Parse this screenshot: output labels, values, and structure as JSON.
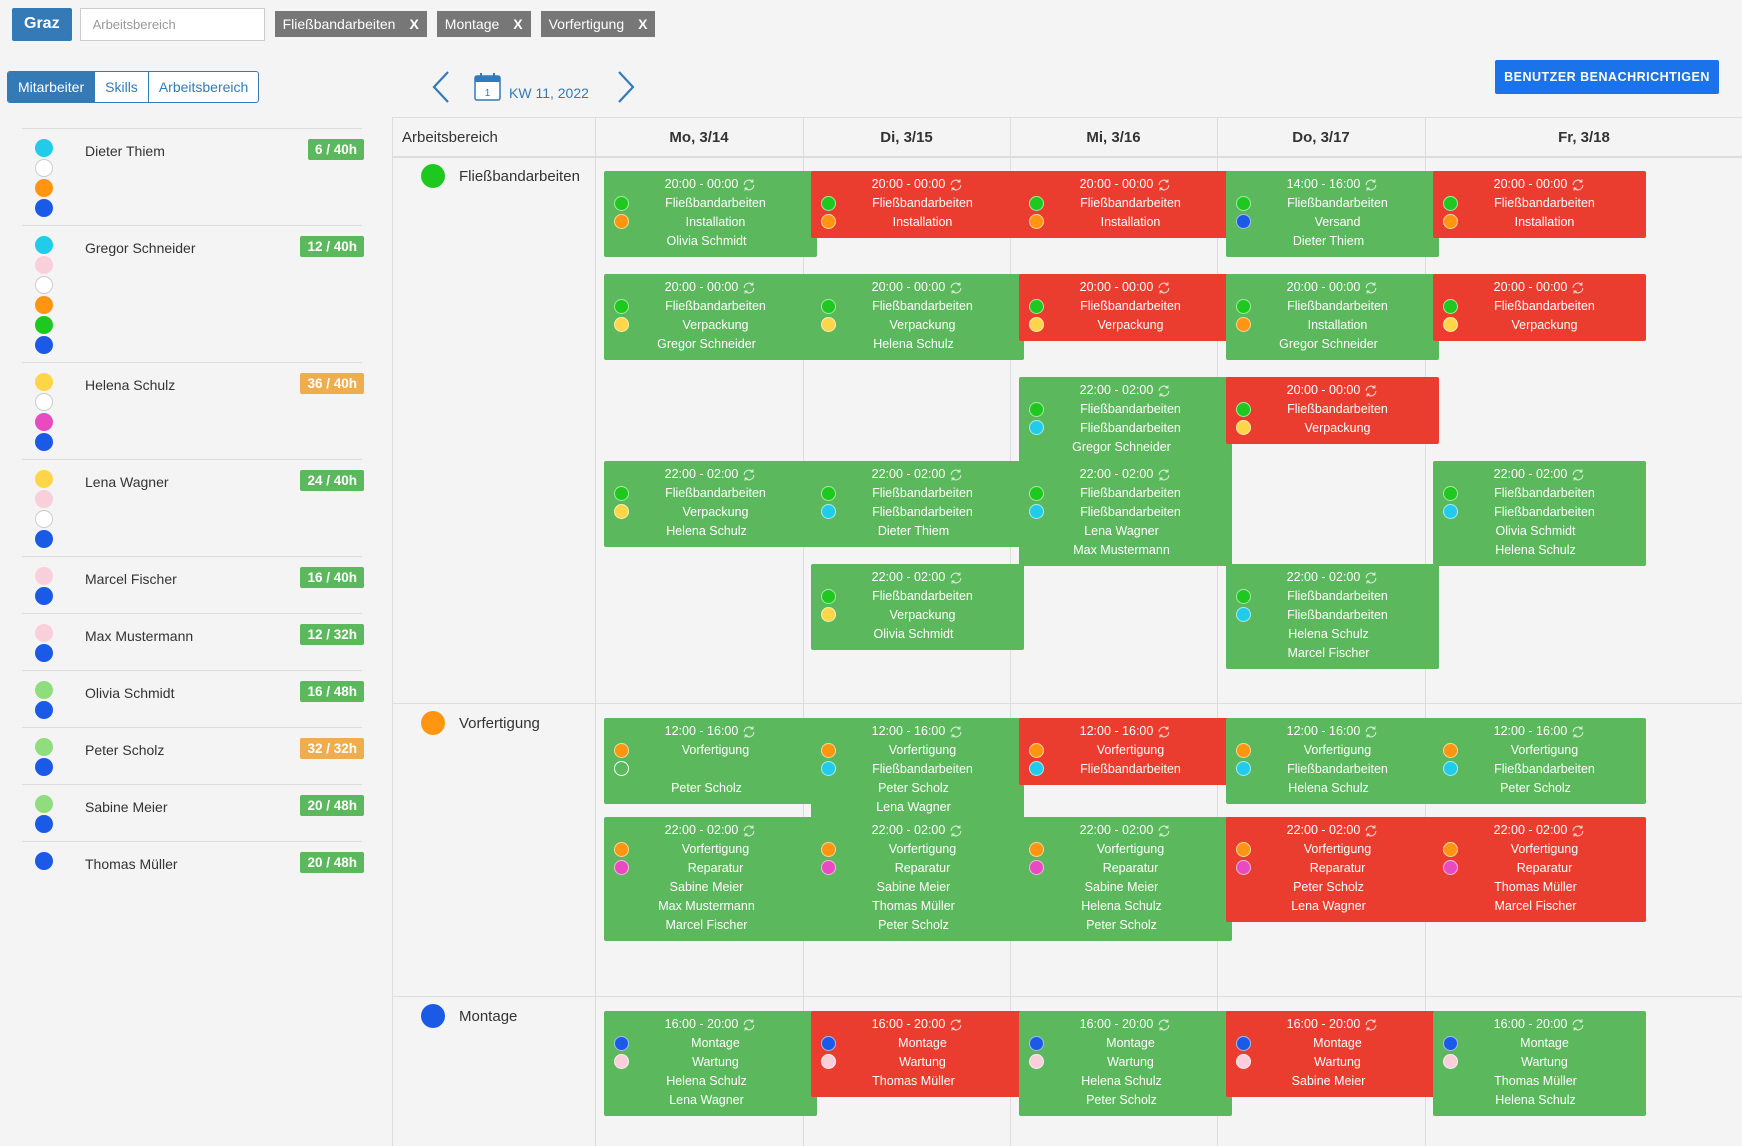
{
  "location": "Graz",
  "area_search": {
    "placeholder": "Arbeitsbereich"
  },
  "filter_chips": [
    {
      "label": "Fließbandarbeiten",
      "remove": "X"
    },
    {
      "label": "Montage",
      "remove": "X"
    },
    {
      "label": "Vorfertigung",
      "remove": "X"
    }
  ],
  "view_tabs": [
    "Mitarbeiter",
    "Skills",
    "Arbeitsbereich"
  ],
  "week": {
    "calendar_day": "1",
    "label": "KW 11, 2022"
  },
  "notify_button": "BENUTZER BENACHRICHTIGEN",
  "colors": {
    "cyan": "#22cbea",
    "pink": "#f9cfdc",
    "orange": "#ff9511",
    "blue": "#1b5ae6",
    "green": "#1fc81f",
    "yellow": "#ffd54a",
    "magenta": "#e84bbf",
    "lightgreen": "#8fdd7d",
    "badge_green": "#5cb85c",
    "badge_orange": "#f0ad4e",
    "card_green": "#5cb85c",
    "card_red": "#ea3c2f"
  },
  "employees": [
    {
      "name": "Dieter Thiem",
      "hours": "6 / 40h",
      "status": "green",
      "skills": [
        "cyan",
        "empty",
        "orange",
        "blue"
      ]
    },
    {
      "name": "Gregor Schneider",
      "hours": "12 / 40h",
      "status": "green",
      "skills": [
        "cyan",
        "pink",
        "empty",
        "orange",
        "green",
        "blue"
      ]
    },
    {
      "name": "Helena Schulz",
      "hours": "36 / 40h",
      "status": "orange",
      "skills": [
        "yellow",
        "empty",
        "magenta",
        "blue"
      ]
    },
    {
      "name": "Lena Wagner",
      "hours": "24 / 40h",
      "status": "green",
      "skills": [
        "yellow",
        "pink",
        "empty",
        "blue"
      ]
    },
    {
      "name": "Marcel Fischer",
      "hours": "16 / 40h",
      "status": "green",
      "skills": [
        "pink",
        "blue"
      ]
    },
    {
      "name": "Max Mustermann",
      "hours": "12 / 32h",
      "status": "green",
      "skills": [
        "pink",
        "blue"
      ]
    },
    {
      "name": "Olivia Schmidt",
      "hours": "16 / 48h",
      "status": "green",
      "skills": [
        "lightgreen",
        "blue"
      ]
    },
    {
      "name": "Peter Scholz",
      "hours": "32 / 32h",
      "status": "orange",
      "skills": [
        "lightgreen",
        "blue"
      ]
    },
    {
      "name": "Sabine Meier",
      "hours": "20 / 48h",
      "status": "green",
      "skills": [
        "lightgreen",
        "blue"
      ]
    },
    {
      "name": "Thomas Müller",
      "hours": "20 / 48h",
      "status": "green",
      "skills": [
        "blue"
      ]
    }
  ],
  "schedule": {
    "area_header": "Arbeitsbereich",
    "days": [
      "Mo, 3/14",
      "Di, 3/15",
      "Mi, 3/16",
      "Do, 3/17",
      "Fr, 3/18"
    ],
    "areas": [
      {
        "name": "Fließbandarbeiten",
        "color": "green"
      },
      {
        "name": "Vorfertigung",
        "color": "orange"
      },
      {
        "name": "Montage",
        "color": "blue"
      }
    ],
    "shifts": [
      {
        "area": 0,
        "day": 0,
        "slot": 0,
        "status": "green",
        "time": "20:00 - 00:00",
        "dots": [
          "green",
          "orange"
        ],
        "lines": [
          "Fließbandarbeiten",
          "Installation",
          "Olivia Schmidt"
        ]
      },
      {
        "area": 0,
        "day": 0,
        "slot": 1,
        "status": "green",
        "time": "20:00 - 00:00",
        "dots": [
          "green",
          "yellow"
        ],
        "lines": [
          "Fließbandarbeiten",
          "Verpackung",
          "Gregor Schneider"
        ]
      },
      {
        "area": 0,
        "day": 0,
        "slot": 3,
        "status": "green",
        "time": "22:00 - 02:00",
        "dots": [
          "green",
          "yellow"
        ],
        "lines": [
          "Fließbandarbeiten",
          "Verpackung",
          "Helena Schulz"
        ]
      },
      {
        "area": 0,
        "day": 1,
        "slot": 0,
        "status": "red",
        "time": "20:00 - 00:00",
        "dots": [
          "green",
          "orange"
        ],
        "lines": [
          "Fließbandarbeiten",
          "Installation"
        ]
      },
      {
        "area": 0,
        "day": 1,
        "slot": 1,
        "status": "green",
        "time": "20:00 - 00:00",
        "dots": [
          "green",
          "yellow"
        ],
        "lines": [
          "Fließbandarbeiten",
          "Verpackung",
          "Helena Schulz"
        ]
      },
      {
        "area": 0,
        "day": 1,
        "slot": 3,
        "status": "green",
        "time": "22:00 - 02:00",
        "dots": [
          "green",
          "cyan"
        ],
        "lines": [
          "Fließbandarbeiten",
          "Fließbandarbeiten",
          "Dieter Thiem"
        ]
      },
      {
        "area": 0,
        "day": 1,
        "slot": 4,
        "status": "green",
        "time": "22:00 - 02:00",
        "dots": [
          "green",
          "yellow"
        ],
        "lines": [
          "Fließbandarbeiten",
          "Verpackung",
          "Olivia Schmidt"
        ]
      },
      {
        "area": 0,
        "day": 2,
        "slot": 0,
        "status": "red",
        "time": "20:00 - 00:00",
        "dots": [
          "green",
          "orange"
        ],
        "lines": [
          "Fließbandarbeiten",
          "Installation"
        ]
      },
      {
        "area": 0,
        "day": 2,
        "slot": 1,
        "status": "red",
        "time": "20:00 - 00:00",
        "dots": [
          "green",
          "yellow"
        ],
        "lines": [
          "Fließbandarbeiten",
          "Verpackung"
        ]
      },
      {
        "area": 0,
        "day": 2,
        "slot": 2,
        "status": "green",
        "time": "22:00 - 02:00",
        "dots": [
          "green",
          "cyan"
        ],
        "lines": [
          "Fließbandarbeiten",
          "Fließbandarbeiten",
          "Gregor Schneider"
        ]
      },
      {
        "area": 0,
        "day": 2,
        "slot": 3,
        "status": "green",
        "time": "22:00 - 02:00",
        "dots": [
          "green",
          "cyan"
        ],
        "lines": [
          "Fließbandarbeiten",
          "Fließbandarbeiten",
          "Lena Wagner",
          "Max Mustermann"
        ]
      },
      {
        "area": 0,
        "day": 3,
        "slot": 0,
        "status": "green",
        "time": "14:00 - 16:00",
        "dots": [
          "green",
          "blue"
        ],
        "lines": [
          "Fließbandarbeiten",
          "Versand",
          "Dieter Thiem"
        ]
      },
      {
        "area": 0,
        "day": 3,
        "slot": 1,
        "status": "green",
        "time": "20:00 - 00:00",
        "dots": [
          "green",
          "orange"
        ],
        "lines": [
          "Fließbandarbeiten",
          "Installation",
          "Gregor Schneider"
        ]
      },
      {
        "area": 0,
        "day": 3,
        "slot": 2,
        "status": "red",
        "time": "20:00 - 00:00",
        "dots": [
          "green",
          "yellow"
        ],
        "lines": [
          "Fließbandarbeiten",
          "Verpackung"
        ]
      },
      {
        "area": 0,
        "day": 3,
        "slot": 4,
        "status": "green",
        "time": "22:00 - 02:00",
        "dots": [
          "green",
          "cyan"
        ],
        "lines": [
          "Fließbandarbeiten",
          "Fließbandarbeiten",
          "Helena Schulz",
          "Marcel Fischer"
        ]
      },
      {
        "area": 0,
        "day": 4,
        "slot": 0,
        "status": "red",
        "time": "20:00 - 00:00",
        "dots": [
          "green",
          "orange"
        ],
        "lines": [
          "Fließbandarbeiten",
          "Installation"
        ]
      },
      {
        "area": 0,
        "day": 4,
        "slot": 1,
        "status": "red",
        "time": "20:00 - 00:00",
        "dots": [
          "green",
          "yellow"
        ],
        "lines": [
          "Fließbandarbeiten",
          "Verpackung"
        ]
      },
      {
        "area": 0,
        "day": 4,
        "slot": 3,
        "status": "green",
        "time": "22:00 - 02:00",
        "dots": [
          "green",
          "cyan"
        ],
        "lines": [
          "Fließbandarbeiten",
          "Fließbandarbeiten",
          "Olivia Schmidt",
          "Helena Schulz"
        ]
      },
      {
        "area": 1,
        "day": 0,
        "slot": 0,
        "status": "green",
        "time": "12:00 - 16:00",
        "dots": [
          "orange",
          "empty"
        ],
        "lines": [
          "Vorfertigung",
          "",
          "Peter Scholz"
        ]
      },
      {
        "area": 1,
        "day": 0,
        "slot": 1,
        "status": "green",
        "time": "22:00 - 02:00",
        "dots": [
          "orange",
          "magenta"
        ],
        "lines": [
          "Vorfertigung",
          "Reparatur",
          "Sabine Meier",
          "Max Mustermann",
          "Marcel Fischer"
        ]
      },
      {
        "area": 1,
        "day": 1,
        "slot": 0,
        "status": "green",
        "time": "12:00 - 16:00",
        "dots": [
          "orange",
          "cyan"
        ],
        "lines": [
          "Vorfertigung",
          "Fließbandarbeiten",
          "Peter Scholz",
          "Lena Wagner"
        ]
      },
      {
        "area": 1,
        "day": 1,
        "slot": 1,
        "status": "green",
        "time": "22:00 - 02:00",
        "dots": [
          "orange",
          "magenta"
        ],
        "lines": [
          "Vorfertigung",
          "Reparatur",
          "Sabine Meier",
          "Thomas Müller",
          "Peter Scholz"
        ]
      },
      {
        "area": 1,
        "day": 2,
        "slot": 0,
        "status": "red",
        "time": "12:00 - 16:00",
        "dots": [
          "orange",
          "cyan"
        ],
        "lines": [
          "Vorfertigung",
          "Fließbandarbeiten"
        ]
      },
      {
        "area": 1,
        "day": 2,
        "slot": 1,
        "status": "green",
        "time": "22:00 - 02:00",
        "dots": [
          "orange",
          "magenta"
        ],
        "lines": [
          "Vorfertigung",
          "Reparatur",
          "Sabine Meier",
          "Helena Schulz",
          "Peter Scholz"
        ]
      },
      {
        "area": 1,
        "day": 3,
        "slot": 0,
        "status": "green",
        "time": "12:00 - 16:00",
        "dots": [
          "orange",
          "cyan"
        ],
        "lines": [
          "Vorfertigung",
          "Fließbandarbeiten",
          "Helena Schulz"
        ]
      },
      {
        "area": 1,
        "day": 3,
        "slot": 1,
        "status": "red",
        "time": "22:00 - 02:00",
        "dots": [
          "orange",
          "magenta"
        ],
        "lines": [
          "Vorfertigung",
          "Reparatur",
          "Peter Scholz",
          "Lena Wagner"
        ]
      },
      {
        "area": 1,
        "day": 4,
        "slot": 0,
        "status": "green",
        "time": "12:00 - 16:00",
        "dots": [
          "orange",
          "cyan"
        ],
        "lines": [
          "Vorfertigung",
          "Fließbandarbeiten",
          "Peter Scholz"
        ]
      },
      {
        "area": 1,
        "day": 4,
        "slot": 1,
        "status": "red",
        "time": "22:00 - 02:00",
        "dots": [
          "orange",
          "magenta"
        ],
        "lines": [
          "Vorfertigung",
          "Reparatur",
          "Thomas Müller",
          "Marcel Fischer"
        ]
      },
      {
        "area": 2,
        "day": 0,
        "slot": 0,
        "status": "green",
        "time": "16:00 - 20:00",
        "dots": [
          "blue",
          "pink"
        ],
        "lines": [
          "Montage",
          "Wartung",
          "Helena Schulz",
          "Lena Wagner"
        ]
      },
      {
        "area": 2,
        "day": 1,
        "slot": 0,
        "status": "red",
        "time": "16:00 - 20:00",
        "dots": [
          "blue",
          "pink"
        ],
        "lines": [
          "Montage",
          "Wartung",
          "Thomas Müller"
        ]
      },
      {
        "area": 2,
        "day": 2,
        "slot": 0,
        "status": "green",
        "time": "16:00 - 20:00",
        "dots": [
          "blue",
          "pink"
        ],
        "lines": [
          "Montage",
          "Wartung",
          "Helena Schulz",
          "Peter Scholz"
        ]
      },
      {
        "area": 2,
        "day": 3,
        "slot": 0,
        "status": "red",
        "time": "16:00 - 20:00",
        "dots": [
          "blue",
          "pink"
        ],
        "lines": [
          "Montage",
          "Wartung",
          "Sabine Meier"
        ]
      },
      {
        "area": 2,
        "day": 4,
        "slot": 0,
        "status": "green",
        "time": "16:00 - 20:00",
        "dots": [
          "blue",
          "pink"
        ],
        "lines": [
          "Montage",
          "Wartung",
          "Thomas Müller",
          "Helena Schulz"
        ]
      }
    ]
  }
}
